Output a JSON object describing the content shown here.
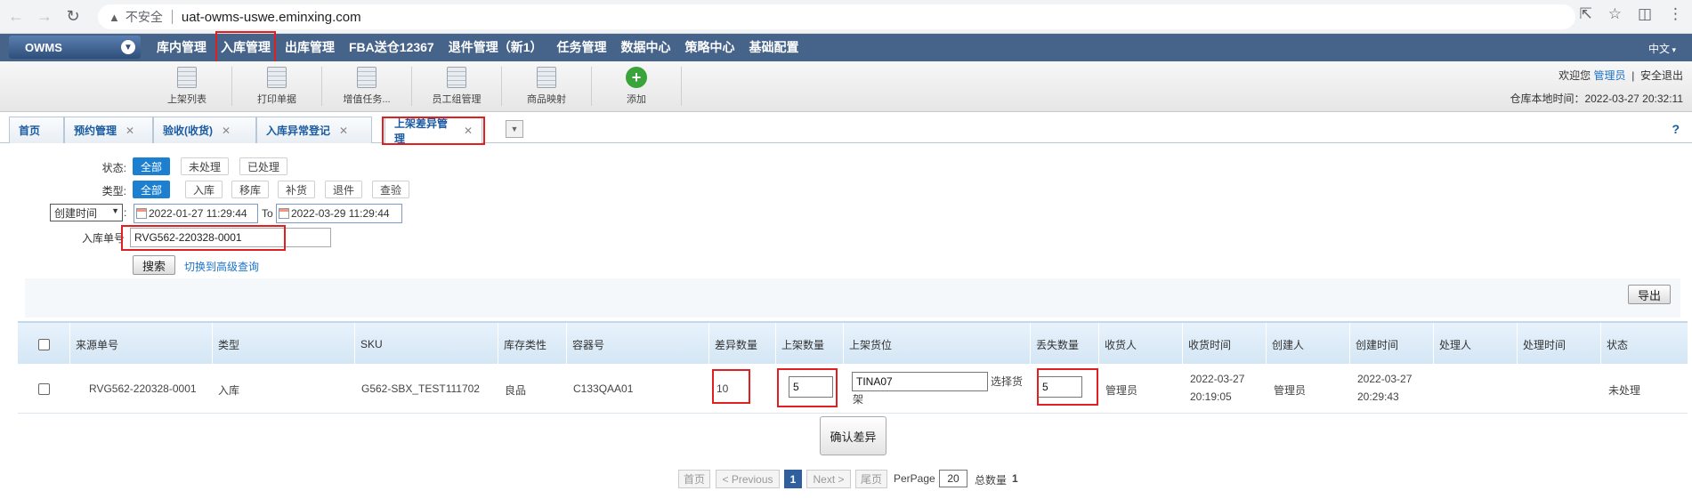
{
  "browser": {
    "security_label": "不安全",
    "url": "uat-owms-uswe.eminxing.com"
  },
  "app": {
    "logo": "OWMS",
    "menu": [
      {
        "label": "库内管理"
      },
      {
        "label": "入库管理"
      },
      {
        "label": "出库管理"
      },
      {
        "label": "FBA送仓12367"
      },
      {
        "label": "退件管理（新1）"
      },
      {
        "label": "任务管理"
      },
      {
        "label": "数据中心"
      },
      {
        "label": "策略中心"
      },
      {
        "label": "基础配置"
      }
    ],
    "language": "中文"
  },
  "toolbar": {
    "tools": [
      "上架列表",
      "打印单据",
      "增值任务...",
      "员工组管理",
      "商品映射",
      "添加"
    ],
    "welcome_prefix": "欢迎您",
    "user": "管理员",
    "divider": "|",
    "logout": "安全退出",
    "local_time_label": "仓库本地时间：",
    "local_time": "2022-03-27 20:32:11"
  },
  "tabs": [
    {
      "label": "首页"
    },
    {
      "label": "预约管理"
    },
    {
      "label": "验收(收货)"
    },
    {
      "label": "入库异常登记"
    },
    {
      "label": "上架差异管理"
    }
  ],
  "help": "?",
  "filters": {
    "status_label": "状态:",
    "status_options": [
      "全部",
      "未处理",
      "已处理"
    ],
    "type_label": "类型:",
    "type_options": [
      "全部",
      "入库",
      "移库",
      "补货",
      "退件",
      "查验"
    ],
    "time_field": "创建时间",
    "colon": ":",
    "date_from": "2022-01-27 11:29:44",
    "to": "To",
    "date_to": "2022-03-29 11:29:44",
    "order_label": "入库单号",
    "order_value": "RVG562-220328-0001",
    "search": "搜索",
    "advanced": "切换到高级查询",
    "export": "导出"
  },
  "table": {
    "headers": [
      "来源单号",
      "类型",
      "SKU",
      "库存类性",
      "容器号",
      "差异数量",
      "上架数量",
      "上架货位",
      "丢失数量",
      "收货人",
      "收货时间",
      "创建人",
      "创建时间",
      "处理人",
      "处理时间",
      "状态"
    ],
    "row": {
      "source_no": "RVG562-220328-0001",
      "type": "入库",
      "sku": "G562-SBX_TEST111702",
      "stock_type": "良品",
      "container": "C133QAA01",
      "diff_qty": "10",
      "putaway_qty": "5",
      "location": "TINA07",
      "select_location_1": "选择货",
      "select_location_2": "架",
      "lost_qty": "5",
      "receiver": "管理员",
      "receive_date": "2022-03-27",
      "receive_time": "20:19:05",
      "creator": "管理员",
      "create_date": "2022-03-27",
      "create_time": "20:29:43",
      "handler": "",
      "handle_time": "",
      "status": "未处理"
    },
    "confirm": "确认差异"
  },
  "pager": {
    "first": "首页",
    "prev": "< Previous",
    "current": "1",
    "next": "Next >",
    "last": "尾页",
    "perpage_label": "PerPage",
    "perpage": "20",
    "total_label": "总数量",
    "total": "1"
  }
}
